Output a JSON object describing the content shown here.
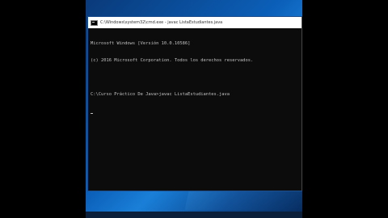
{
  "window": {
    "title": "C:\\Windows\\system32\\cmd.exe - javac ListaEstudiantes.java",
    "icon": "cmd-icon"
  },
  "console": {
    "lines": [
      "Microsoft Windows [Versión 10.0.10586]",
      "(c) 2016 Microsoft Corporation. Todos los derechos reservados.",
      "",
      "C:\\Curso Práctico De Java>javac ListaEstudiantes.java"
    ]
  },
  "colors": {
    "console_bg": "#0c0c0c",
    "console_text": "#c0c0c0",
    "desktop_accent": "#0b5fb8"
  }
}
